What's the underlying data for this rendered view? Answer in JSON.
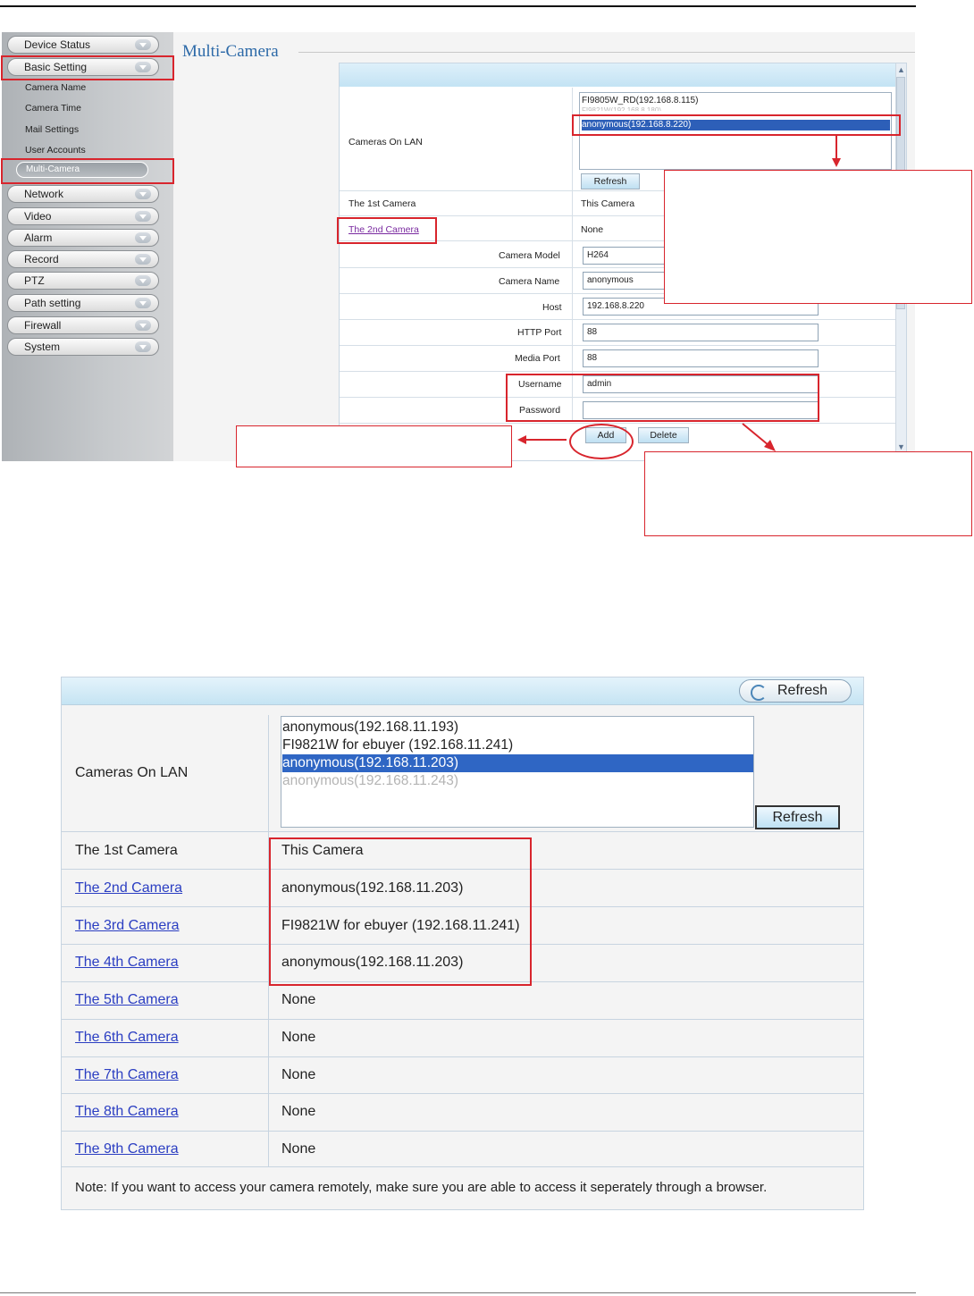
{
  "top_screenshot": {
    "page_title": "Multi-Camera",
    "nav": {
      "device_status": "Device Status",
      "basic_setting": "Basic Setting",
      "sub_items": [
        "Camera Name",
        "Camera Time",
        "Mail Settings",
        "User Accounts",
        "Multi-Camera"
      ],
      "network": "Network",
      "video": "Video",
      "alarm": "Alarm",
      "record": "Record",
      "ptz": "PTZ",
      "path_setting": "Path setting",
      "firewall": "Firewall",
      "system": "System"
    },
    "cameras_on_lan_label": "Cameras On LAN",
    "lan_list": [
      "FI9805W_RD(192.168.8.115)",
      "FI9821W(192.168.8.180)",
      "anonymous(192.168.8.220)"
    ],
    "refresh_label": "Refresh",
    "first_camera_label": "The 1st Camera",
    "first_camera_value": "This Camera",
    "second_camera_label": "The 2nd Camera",
    "second_camera_value": "None",
    "fields": {
      "camera_model_label": "Camera Model",
      "camera_model_value": "H264",
      "camera_name_label": "Camera Name",
      "camera_name_value": "anonymous",
      "host_label": "Host",
      "host_value": "192.168.8.220",
      "http_port_label": "HTTP Port",
      "http_port_value": "88",
      "media_port_label": "Media Port",
      "media_port_value": "88",
      "username_label": "Username",
      "username_value": "admin",
      "password_label": "Password",
      "password_value": ""
    },
    "add_label": "Add",
    "delete_label": "Delete"
  },
  "bottom_screenshot": {
    "refresh_top_label": "Refresh",
    "cameras_on_lan_label": "Cameras On LAN",
    "lan_list": [
      "anonymous(192.168.11.193)",
      "FI9821W for ebuyer (192.168.11.241)",
      "anonymous(192.168.11.203)",
      "anonymous(192.168.11.243)"
    ],
    "refresh_label": "Refresh",
    "rows": [
      {
        "label": "The 1st Camera",
        "value": "This Camera"
      },
      {
        "label": "The 2nd Camera",
        "value": "anonymous(192.168.11.203)"
      },
      {
        "label": "The 3rd Camera",
        "value": "FI9821W for ebuyer (192.168.11.241)"
      },
      {
        "label": "The 4th Camera",
        "value": "anonymous(192.168.11.203)"
      },
      {
        "label": "The 5th Camera",
        "value": "None"
      },
      {
        "label": "The 6th Camera",
        "value": "None"
      },
      {
        "label": "The 7th Camera",
        "value": "None"
      },
      {
        "label": "The 8th Camera",
        "value": "None"
      },
      {
        "label": "The 9th Camera",
        "value": "None"
      }
    ],
    "note": "Note: If you want to access your camera remotely, make sure you are able to access it seperately through a browser."
  },
  "colors": {
    "annotation_red": "#d8252d",
    "link_blue": "#2b3ec2",
    "selection_blue": "#2f66c4"
  }
}
